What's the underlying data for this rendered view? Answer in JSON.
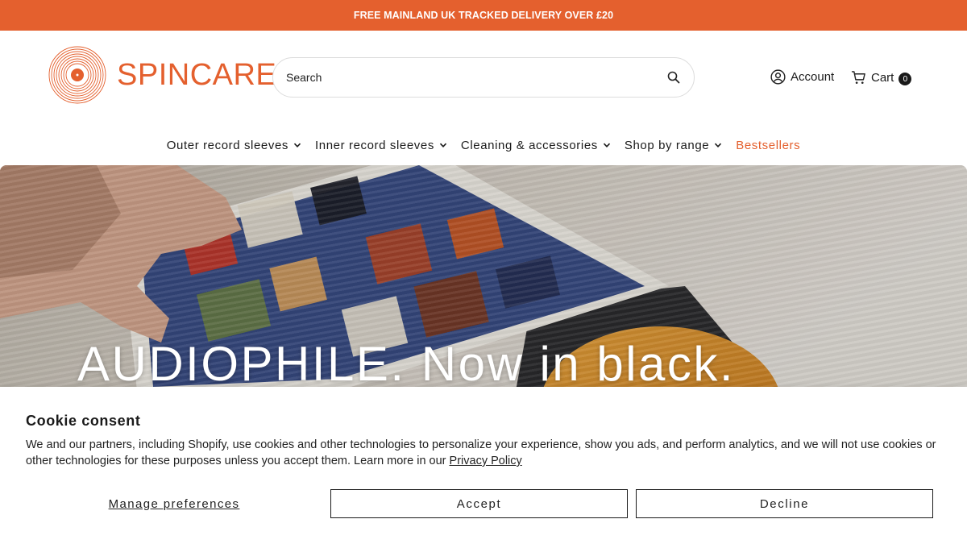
{
  "announcement": {
    "text": "FREE MAINLAND UK TRACKED DELIVERY OVER £20"
  },
  "header": {
    "logo_text": "SPINCARE",
    "search": {
      "placeholder": "Search"
    },
    "account_label": "Account",
    "cart_label": "Cart",
    "cart_count": "0"
  },
  "nav": {
    "items": [
      {
        "label": "Outer record sleeves"
      },
      {
        "label": "Inner record sleeves"
      },
      {
        "label": "Cleaning & accessories"
      },
      {
        "label": "Shop by range"
      },
      {
        "label": "Bestsellers"
      }
    ]
  },
  "hero": {
    "title": "AUDIOPHILE. Now in black."
  },
  "cookie": {
    "title": "Cookie consent",
    "text": "We and our partners, including Shopify, use cookies and other technologies to personalize your experience, show you ads, and perform analytics, and we will not use cookies or other technologies for these purposes unless you accept them. Learn more in our ",
    "privacy_link": "Privacy Policy",
    "manage_label": "Manage preferences",
    "accept_label": "Accept",
    "decline_label": "Decline"
  },
  "colors": {
    "brand": "#e4602e",
    "text": "#1a1a1a"
  }
}
